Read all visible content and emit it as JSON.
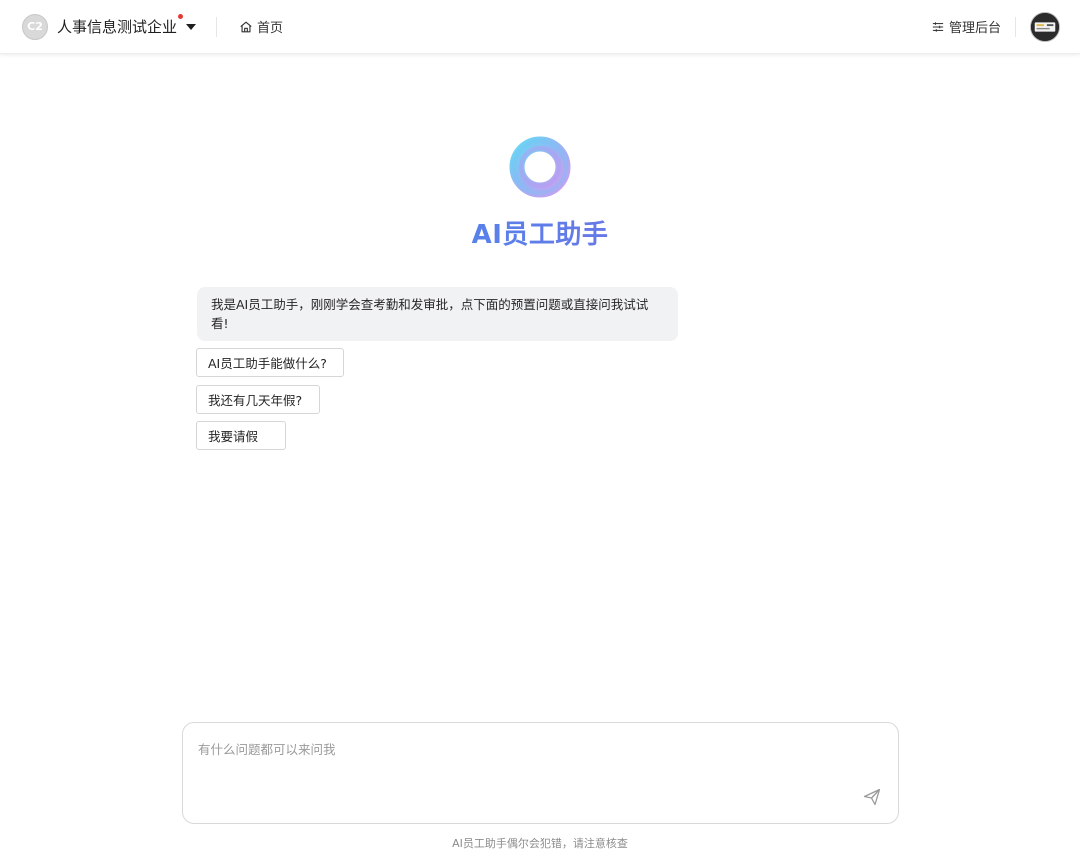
{
  "header": {
    "org_logo_text": "C2",
    "org_name": "人事信息测试企业",
    "home_label": "首页",
    "admin_label": "管理后台"
  },
  "hero": {
    "title": "AI员工助手"
  },
  "chat": {
    "greeting": "我是AI员工助手，刚刚学会查考勤和发审批，点下面的预置问题或直接问我试试看!",
    "suggestions": [
      "AI员工助手能做什么?",
      "我还有几天年假?",
      "我要请假"
    ]
  },
  "input": {
    "placeholder": "有什么问题都可以来问我",
    "value": ""
  },
  "footer": {
    "disclaimer": "AI员工助手偶尔会犯错，请注意核查"
  },
  "colors": {
    "title_gradient_start": "#2a9df4",
    "title_gradient_end": "#9b59d6",
    "notice_dot": "#e53935"
  },
  "icons": {
    "org_logo": "org-logo-icon",
    "dropdown": "caret-down-icon",
    "home": "home-icon",
    "admin": "sliders-icon",
    "send": "send-icon",
    "assistant": "ring-logo-icon"
  }
}
